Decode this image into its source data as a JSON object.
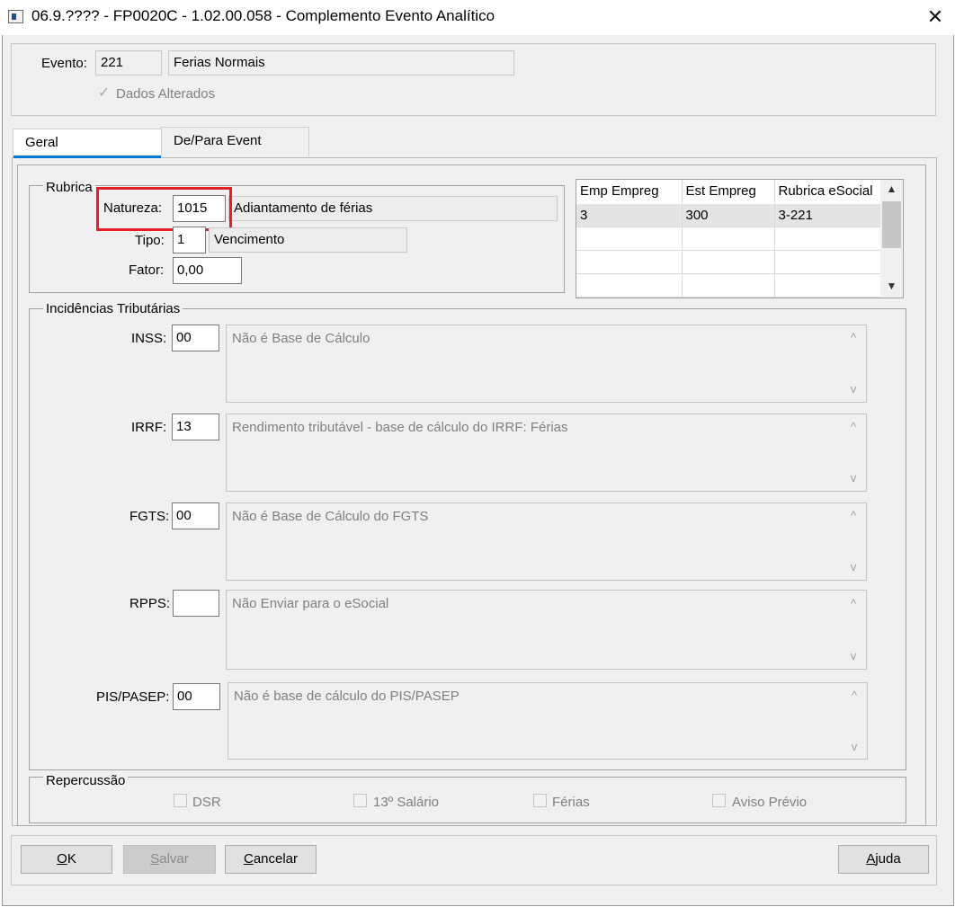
{
  "window": {
    "title": "06.9.???? - FP0020C - 1.02.00.058 - Complemento Evento Analítico",
    "close_glyph": "✕"
  },
  "header": {
    "evento_label": "Evento:",
    "evento_code": "221",
    "evento_desc": "Ferias Normais",
    "dados_alterados_label": "Dados Alterados",
    "dados_alterados_checked": true
  },
  "tabs": [
    {
      "label": "Geral",
      "active": true
    },
    {
      "label": "De/Para Event",
      "active": false
    }
  ],
  "rubrica": {
    "group_title": "Rubrica",
    "natureza_label": "Natureza:",
    "natureza_value": "1015",
    "natureza_desc": "Adiantamento de férias",
    "tipo_label": "Tipo:",
    "tipo_value": "1",
    "tipo_desc": "Vencimento",
    "fator_label": "Fator:",
    "fator_value": "0,00"
  },
  "grid": {
    "columns": [
      "Emp Empreg",
      "Est Empreg",
      "Rubrica eSocial"
    ],
    "rows": [
      [
        "3",
        "300",
        "3-221"
      ],
      [
        "",
        "",
        ""
      ],
      [
        "",
        "",
        ""
      ],
      [
        "",
        "",
        ""
      ]
    ]
  },
  "incidencias": {
    "group_title": "Incidências Tributárias",
    "items": [
      {
        "label": "INSS:",
        "code": "00",
        "desc": "Não é Base de Cálculo"
      },
      {
        "label": "IRRF:",
        "code": "13",
        "desc": "Rendimento tributável - base de cálculo do IRRF: Férias"
      },
      {
        "label": "FGTS:",
        "code": "00",
        "desc": "Não é Base de Cálculo do FGTS"
      },
      {
        "label": "RPPS:",
        "code": "",
        "desc": "Não Enviar para o eSocial"
      },
      {
        "label": "PIS/PASEP:",
        "code": "00",
        "desc": "Não é base de cálculo do PIS/PASEP"
      }
    ]
  },
  "repercussao": {
    "group_title": "Repercussão",
    "options": [
      "DSR",
      "13º Salário",
      "Férias",
      "Aviso Prévio"
    ]
  },
  "buttons": {
    "ok": {
      "underlined": "O",
      "rest": "K"
    },
    "salvar": {
      "underlined": "S",
      "rest": "alvar"
    },
    "cancelar": {
      "underlined": "C",
      "rest": "ancelar"
    },
    "ajuda": {
      "underlined": "A",
      "rest": "juda"
    }
  },
  "colors": {
    "highlight": "#e3202a",
    "tab_accent": "#0078d7"
  }
}
